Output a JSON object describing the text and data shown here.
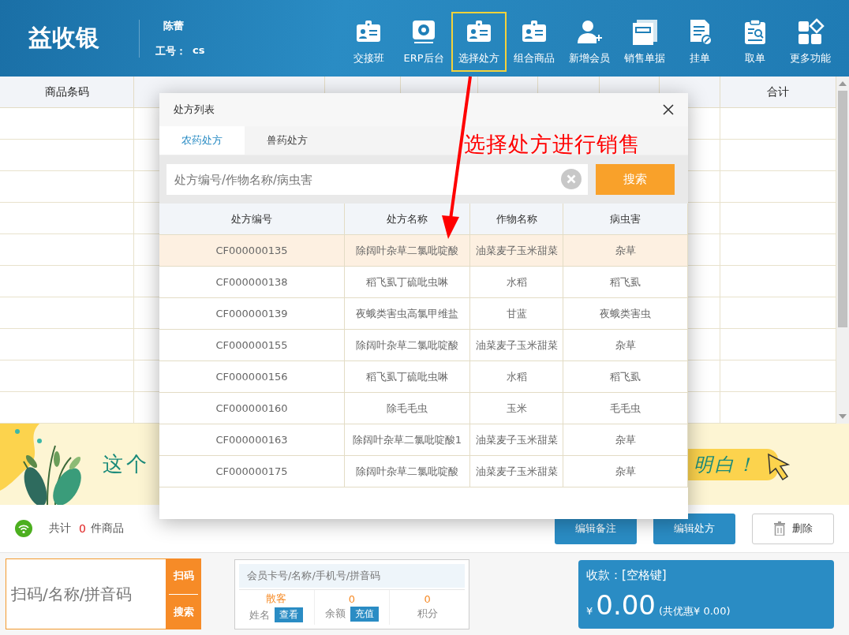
{
  "header": {
    "logo": "益收银",
    "user_name": "陈蕾",
    "id_label": "工号：",
    "id_value": "cs"
  },
  "toolbar": [
    {
      "label": "交接班",
      "kind": "badge",
      "selected": false
    },
    {
      "label": "ERP后台",
      "kind": "monitor",
      "selected": false
    },
    {
      "label": "选择处方",
      "kind": "badge",
      "selected": true
    },
    {
      "label": "组合商品",
      "kind": "badge",
      "selected": false
    },
    {
      "label": "新增会员",
      "kind": "person",
      "selected": false
    },
    {
      "label": "销售单据",
      "kind": "docs",
      "selected": false
    },
    {
      "label": "挂单",
      "kind": "edit",
      "selected": false
    },
    {
      "label": "取单",
      "kind": "clipboard",
      "selected": false
    },
    {
      "label": "更多功能",
      "kind": "tiles",
      "selected": false
    }
  ],
  "table": {
    "first_column": "商品条码",
    "last_column": "合计"
  },
  "banner": {
    "left_text": "这个",
    "right_text": "明白！"
  },
  "dialog": {
    "title": "处方列表",
    "tabs": [
      {
        "label": "农药处方",
        "selected": true
      },
      {
        "label": "兽药处方",
        "selected": false
      }
    ],
    "search_placeholder": "处方编号/作物名称/病虫害",
    "search_button": "搜索",
    "columns": [
      "处方编号",
      "处方名称",
      "作物名称",
      "病虫害"
    ],
    "rows": [
      {
        "code": "CF000000135",
        "name": "除阔叶杂草二氯吡啶酸",
        "crop": "油菜麦子玉米甜菜",
        "pest": "杂草",
        "selected": true
      },
      {
        "code": "CF000000138",
        "name": "稻飞虱丁硫吡虫啉",
        "crop": "水稻",
        "pest": "稻飞虱",
        "selected": false
      },
      {
        "code": "CF000000139",
        "name": "夜蛾类害虫高氯甲维盐",
        "crop": "甘蓝",
        "pest": "夜蛾类害虫",
        "selected": false
      },
      {
        "code": "CF000000155",
        "name": "除阔叶杂草二氯吡啶酸",
        "crop": "油菜麦子玉米甜菜",
        "pest": "杂草",
        "selected": false
      },
      {
        "code": "CF000000156",
        "name": "稻飞虱丁硫吡虫啉",
        "crop": "水稻",
        "pest": "稻飞虱",
        "selected": false
      },
      {
        "code": "CF000000160",
        "name": "除毛毛虫",
        "crop": "玉米",
        "pest": "毛毛虫",
        "selected": false
      },
      {
        "code": "CF000000163",
        "name": "除阔叶杂草二氯吡啶酸1",
        "crop": "油菜麦子玉米甜菜",
        "pest": "杂草",
        "selected": false
      },
      {
        "code": "CF000000175",
        "name": "除阔叶杂草二氯吡啶酸",
        "crop": "油菜麦子玉米甜菜",
        "pest": "杂草",
        "selected": false
      }
    ]
  },
  "annotation": {
    "text": "选择处方进行销售"
  },
  "summary": {
    "label": "共计",
    "count": "0",
    "unit": "件商品"
  },
  "actions": [
    {
      "label": "编辑备注",
      "kind": "primary"
    },
    {
      "label": "编辑处方",
      "kind": "primary"
    },
    {
      "label": "删除",
      "kind": "delete"
    }
  ],
  "scan": {
    "placeholder": "扫码/名称/拼音码",
    "buttons": [
      "扫码",
      "搜索"
    ]
  },
  "member": {
    "placeholder": "会员卡号/名称/手机号/拼音码",
    "stats": [
      {
        "value": "散客",
        "label": "姓名",
        "action": "查看"
      },
      {
        "value": "0",
        "label": "余额",
        "action": "充值"
      },
      {
        "value": "0",
        "label": "积分"
      }
    ]
  },
  "payment": {
    "title": "收款：[空格键]",
    "currency": "¥",
    "amount": "0.00",
    "discount": "(共优惠¥ 0.00)"
  }
}
